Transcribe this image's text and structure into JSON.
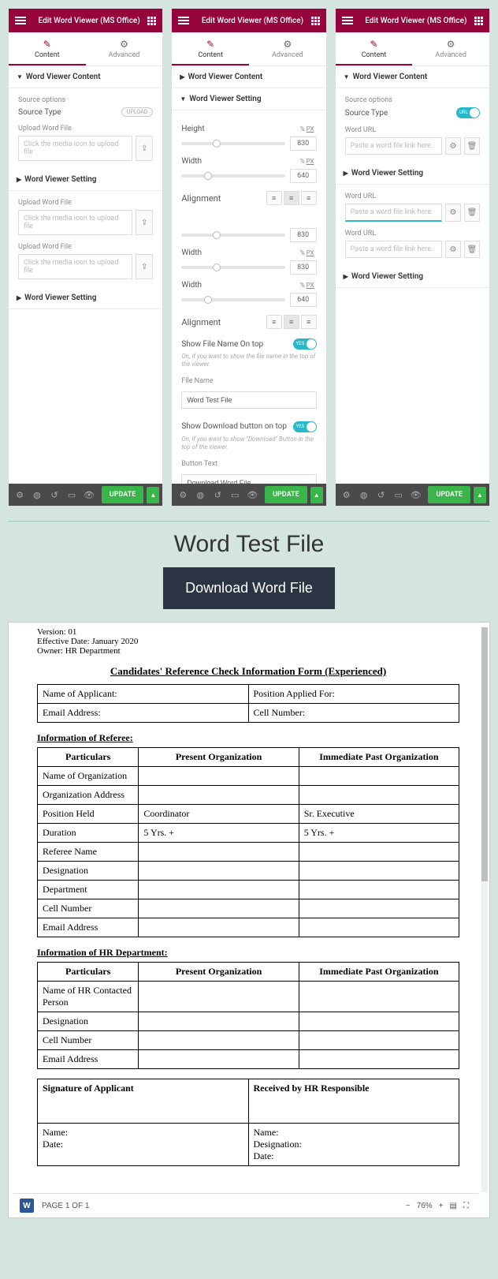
{
  "panel_header": {
    "title": "Edit Word Viewer (MS Office)"
  },
  "tabs": {
    "content": "Content",
    "advanced": "Advanced"
  },
  "sections": {
    "wv_content": "Word Viewer Content",
    "wv_setting": "Word Viewer Setting"
  },
  "labels": {
    "source_options": "Source options",
    "source_type": "Source Type",
    "upload_word_file": "Upload Word File",
    "word_url": "Word URL",
    "height": "Height",
    "width": "Width",
    "alignment": "Alignment",
    "show_file_name": "Show File Name On top",
    "file_name": "File Name",
    "show_download": "Show Download button on top",
    "button_text": "Button Text",
    "px": "PX",
    "pct": "%"
  },
  "placeholders": {
    "upload": "Click the media icon to upload file",
    "url": "Paste a word file link here."
  },
  "pills": {
    "upload": "UPLOAD",
    "url": "URL"
  },
  "help": {
    "filename": "On, if you want to show the file name in the top of the viewer.",
    "download": "On, if you want to show \"Download\" Button in the top of the viewer."
  },
  "values": {
    "height": "830",
    "width": "640",
    "file_name": "Word Test File",
    "button_text": "Download Word File"
  },
  "footer": {
    "update": "UPDATE"
  },
  "preview": {
    "title": "Word Test File",
    "download": "Download Word File",
    "meta": {
      "version": "Version: 01",
      "effective": "Effective Date: January 2020",
      "owner": "Owner: HR Department"
    },
    "doc_title": "Candidates' Reference Check Information Form (Experienced)",
    "top_grid": {
      "name_applicant": "Name of Applicant:",
      "position_applied": "Position Applied For:",
      "email": "Email Address:",
      "cell": "Cell Number:"
    },
    "sec1": "Information of Referee:",
    "tbl_headers": {
      "particulars": "Particulars",
      "present": "Present Organization",
      "past": "Immediate Past Organization"
    },
    "rows1": [
      {
        "p": "Name of Organization",
        "a": "",
        "b": ""
      },
      {
        "p": "Organization Address",
        "a": "",
        "b": ""
      },
      {
        "p": "Position Held",
        "a": "Coordinator",
        "b": "Sr. Executive"
      },
      {
        "p": "Duration",
        "a": "5 Yrs. +",
        "b": "5 Yrs. +"
      },
      {
        "p": "Referee Name",
        "a": "",
        "b": ""
      },
      {
        "p": "Designation",
        "a": "",
        "b": ""
      },
      {
        "p": "Department",
        "a": "",
        "b": ""
      },
      {
        "p": "Cell Number",
        "a": "",
        "b": ""
      },
      {
        "p": "Email Address",
        "a": "",
        "b": ""
      }
    ],
    "sec2": "Information of HR Department:",
    "rows2": [
      {
        "p": "Name of HR Contacted Person",
        "a": "",
        "b": ""
      },
      {
        "p": "Designation",
        "a": "",
        "b": ""
      },
      {
        "p": "Cell Number",
        "a": "",
        "b": ""
      },
      {
        "p": "Email Address",
        "a": "",
        "b": ""
      }
    ],
    "sig": {
      "left_h": "Signature of Applicant",
      "right_h": "Received by HR Responsible",
      "name": "Name:",
      "designation": "Designation:",
      "date": "Date:"
    },
    "status": {
      "page": "PAGE 1 OF 1",
      "zoom": "76%"
    }
  }
}
